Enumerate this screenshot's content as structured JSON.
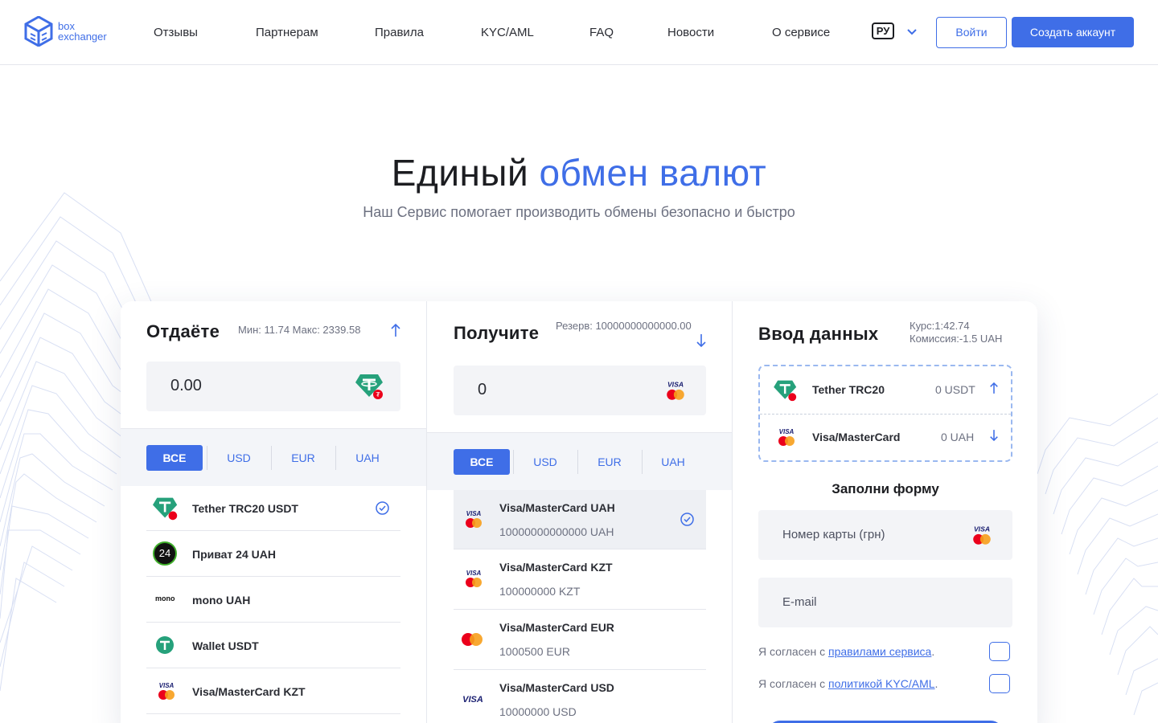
{
  "brand": {
    "line1": "box",
    "line2": "exchanger"
  },
  "nav": [
    "Отзывы",
    "Партнерам",
    "Правила",
    "KYC/AML",
    "FAQ",
    "Новости",
    "О сервисе"
  ],
  "lang": "РУ",
  "header_buttons": {
    "login": "Войти",
    "signup": "Создать аккаунт"
  },
  "hero": {
    "title_part1": "Единый",
    "title_part2": "обмен валют",
    "subtitle": "Наш Сервис помогает производить обмены безопасно и быстро"
  },
  "give": {
    "title": "Отдаёте",
    "limits": "Мин: 11.74   Макс: 2339.58",
    "amount": "0.00",
    "tabs": [
      "ВСЕ",
      "USD",
      "EUR",
      "UAH"
    ],
    "active_tab": "ВСЕ",
    "items": [
      {
        "name": "Tether TRC20 USDT",
        "icon": "tether-trc20-icon",
        "selected": true
      },
      {
        "name": "Приват 24 UAH",
        "icon": "privat24-icon",
        "icon_text": "24"
      },
      {
        "name": "mono UAH",
        "icon": "mono-icon",
        "icon_text": "mono"
      },
      {
        "name": "Wallet USDT",
        "icon": "tether-icon"
      },
      {
        "name": "Visa/MasterCard KZT",
        "icon": "visa-mastercard-icon"
      }
    ]
  },
  "receive": {
    "title": "Получите",
    "reserve": "Резерв: 10000000000000.00",
    "amount": "0",
    "tabs": [
      "ВСЕ",
      "USD",
      "EUR",
      "UAH"
    ],
    "active_tab": "ВСЕ",
    "items": [
      {
        "name": "Visa/MasterCard UAH",
        "reserve": "10000000000000 UAH",
        "icon": "visa-mastercard-icon",
        "selected": true
      },
      {
        "name": "Visa/MasterCard KZT",
        "reserve": "100000000 KZT",
        "icon": "visa-mastercard-icon"
      },
      {
        "name": "Visa/MasterCard EUR",
        "reserve": "1000500 EUR",
        "icon": "mastercard-icon"
      },
      {
        "name": "Visa/MasterCard USD",
        "reserve": "10000000 USD",
        "icon": "visa-icon"
      }
    ]
  },
  "data_entry": {
    "title": "Ввод данных",
    "rate": "Курс:1:42.74",
    "commission": "Комиссия:-1.5 UAH",
    "from": {
      "name": "Tether TRC20",
      "amount": "0 USDT"
    },
    "to": {
      "name": "Visa/MasterCard",
      "amount": "0 UAH"
    },
    "form_title": "Заполни форму",
    "card_placeholder": "Номер карты (грн)",
    "email_placeholder": "E-mail",
    "agree_prefix": "Я согласен с",
    "agree_rules_link": "правилами сервиса",
    "agree_kyc_link": "политикой KYC/AML",
    "agree_suffix": "."
  },
  "colors": {
    "accent": "#3f6ee7",
    "tether": "#26a17b",
    "mastercard_red": "#eb001b",
    "mastercard_orange": "#f79e1b",
    "visa_blue": "#1a1f71"
  }
}
